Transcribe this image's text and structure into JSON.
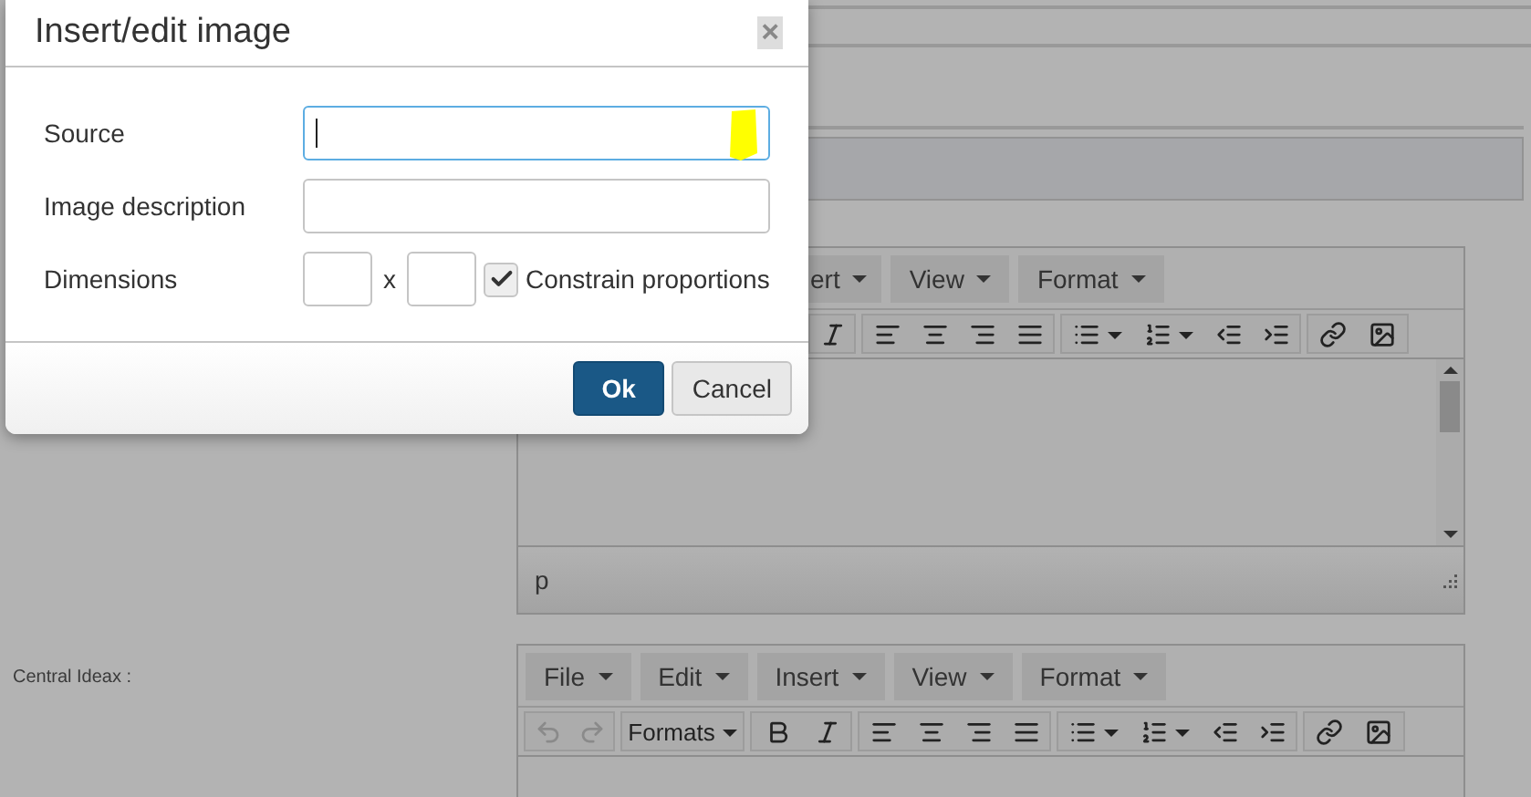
{
  "dialog": {
    "title": "Insert/edit image",
    "close": "×",
    "fields": [
      {
        "label": "Source",
        "kind": "text",
        "focused": true
      },
      {
        "label": "Image description",
        "kind": "text",
        "focused": false
      },
      {
        "label": "Dimensions",
        "kind": "dimensions",
        "separator": "x",
        "constrain": {
          "label": "Constrain proportions",
          "checked": true
        }
      }
    ],
    "buttons": [
      {
        "label": "Ok",
        "primary": true
      },
      {
        "label": "Cancel",
        "primary": false
      }
    ]
  },
  "editors": [
    {
      "menu": [
        {
          "label": "ert",
          "partial": true
        },
        {
          "label": "View",
          "partial": false
        },
        {
          "label": "Format",
          "partial": false
        }
      ],
      "toolbar": [
        {
          "kind": "italic"
        },
        {
          "kind": "align"
        },
        {
          "kind": "lists"
        },
        {
          "kind": "insert"
        }
      ],
      "status": "p"
    },
    {
      "label": "Central Ideax :",
      "menu": [
        {
          "label": "File",
          "partial": false
        },
        {
          "label": "Edit",
          "partial": false
        },
        {
          "label": "Insert",
          "partial": false
        },
        {
          "label": "View",
          "partial": false
        },
        {
          "label": "Format",
          "partial": false
        }
      ],
      "toolbar": [
        {
          "kind": "history",
          "disabled": true
        },
        {
          "kind": "formats",
          "label": "Formats"
        },
        {
          "kind": "bold_italic"
        },
        {
          "kind": "align"
        },
        {
          "kind": "lists"
        },
        {
          "kind": "insert"
        }
      ]
    }
  ]
}
